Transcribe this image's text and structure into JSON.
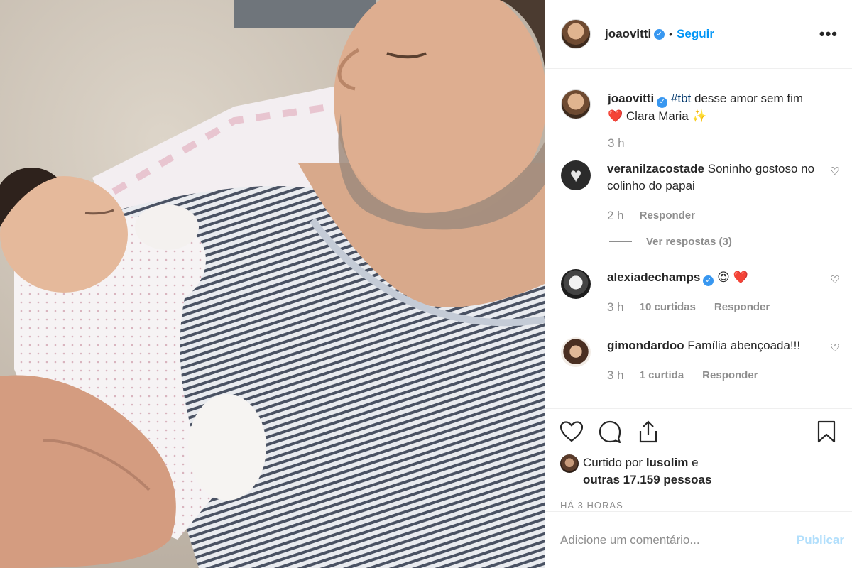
{
  "post": {
    "owner": "joaovitti",
    "follow_label": "Seguir",
    "more_label": "•••",
    "caption_hashtag": "#tbt",
    "caption_text": " desse amor sem fim",
    "caption_line2": "❤️  Clara Maria ✨",
    "caption_time": "3 h"
  },
  "comments": [
    {
      "user": "veranilzacostade",
      "text": "Soninho gostoso no colinho do papai",
      "time": "2 h",
      "likes": "",
      "reply_label": "Responder",
      "view_replies": "Ver respostas (3)"
    },
    {
      "user": "alexiadechamps",
      "text": "😍 ❤️",
      "time": "3 h",
      "likes": "10 curtidas",
      "reply_label": "Responder"
    },
    {
      "user": "gimondardoo",
      "text": "Família abençoada!!!",
      "time": "3 h",
      "likes": "1 curtida",
      "reply_label": "Responder"
    }
  ],
  "likes": {
    "prefix": "Curtido por ",
    "user": "lusolim",
    "middle": " e",
    "others": "outras 17.159 pessoas"
  },
  "timestamp": "HÁ 3 HORAS",
  "add_comment": {
    "placeholder": "Adicione um comentário...",
    "publish_label": "Publicar"
  },
  "colors": {
    "link": "#0095f6",
    "hashtag": "#00376b",
    "muted": "#8e8e8e",
    "verified": "#3897f0"
  }
}
